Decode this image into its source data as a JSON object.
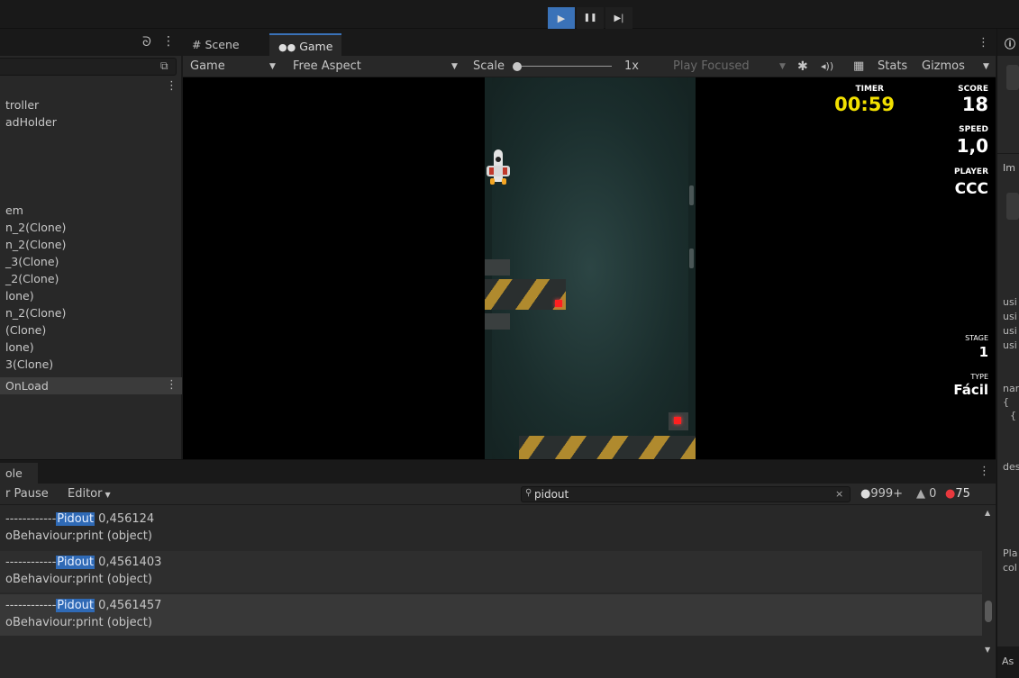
{
  "toolbar": {
    "play": "▶",
    "pause": "❚❚",
    "step": "▶|"
  },
  "hierarchy": {
    "items": [
      {
        "label": "troller"
      },
      {
        "label": "adHolder"
      },
      {
        "label": "em"
      },
      {
        "label": "n_2(Clone)"
      },
      {
        "label": "n_2(Clone)"
      },
      {
        "label": "_3(Clone)"
      },
      {
        "label": "_2(Clone)"
      },
      {
        "label": "lone)"
      },
      {
        "label": "n_2(Clone)"
      },
      {
        "label": "(Clone)"
      },
      {
        "label": "lone)"
      },
      {
        "label": "3(Clone)"
      },
      {
        "label": "OnLoad"
      }
    ]
  },
  "game_tabs": {
    "scene": "Scene",
    "game": "Game"
  },
  "game_options": {
    "display": "Game",
    "aspect": "Free Aspect",
    "scale_label": "Scale",
    "scale_value": "1x",
    "play_mode": "Play Focused",
    "stats": "Stats",
    "gizmos": "Gizmos"
  },
  "hud": {
    "timer_label": "TIMER",
    "timer_value": "00:59",
    "score_label": "SCORE",
    "score_value": "18",
    "speed_label": "SPEED",
    "speed_value": "1,0",
    "player_label": "PLAYER",
    "player_value": "CCC",
    "stage_label": "STAGE",
    "stage_value": "1",
    "type_label": "TYPE",
    "type_value": "Fácil"
  },
  "right_panel": {
    "imp": "Im",
    "lines": [
      "usi",
      "usi",
      "usi",
      "usi",
      "nar",
      "{",
      "{",
      "des",
      "Pla",
      "col",
      "As"
    ]
  },
  "console": {
    "tab": "ole",
    "pause": "r Pause",
    "editor": "Editor",
    "search": "pidout",
    "count_info": "999+",
    "count_warn": "0",
    "count_error": "75",
    "logs": [
      {
        "dashes": "------------",
        "keyword": "Pidout",
        "value": " 0,456124",
        "trace": "oBehaviour:print (object)"
      },
      {
        "dashes": "------------",
        "keyword": "Pidout",
        "value": " 0,4561403",
        "trace": "oBehaviour:print (object)"
      },
      {
        "dashes": "------------",
        "keyword": "Pidout",
        "value": " 0,4561457",
        "trace": "oBehaviour:print (object)"
      }
    ]
  },
  "colors": {
    "accent": "#2f6ab6",
    "timer": "#f2e000",
    "error": "#e8383d"
  }
}
